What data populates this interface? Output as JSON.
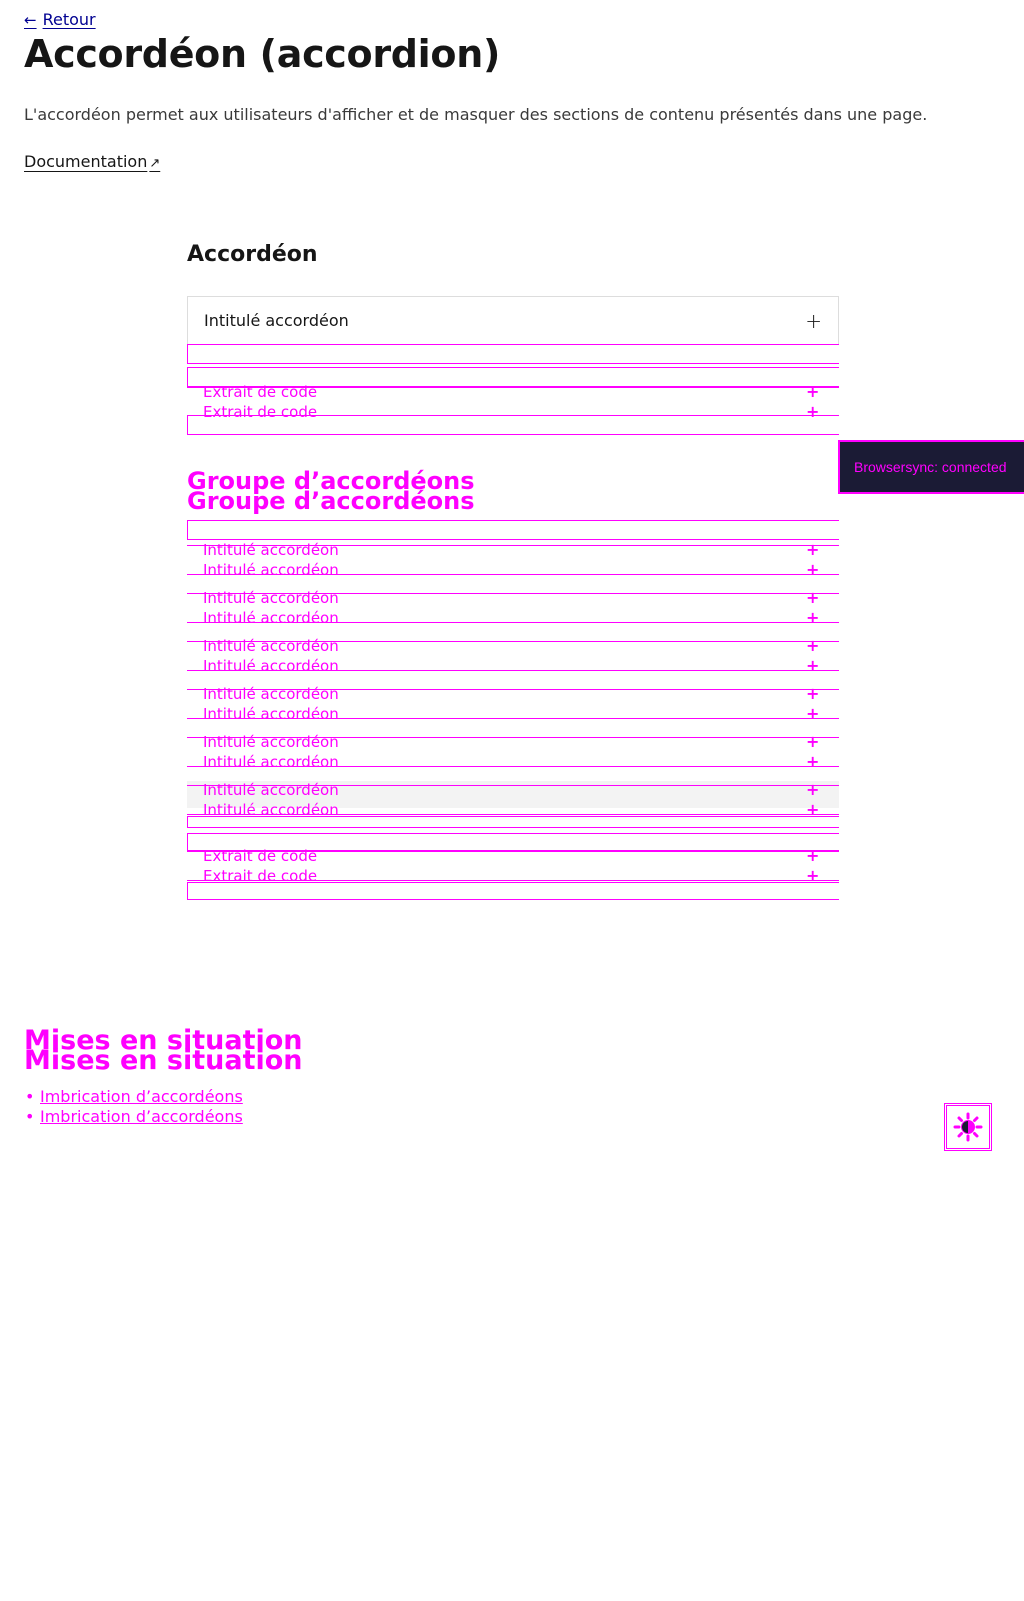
{
  "nav": {
    "back_label": "Retour"
  },
  "header": {
    "title": "Accordéon (accordion)",
    "description": "L'accordéon permet aux utilisateurs d'afficher et de masquer des sections de contenu présentés dans une page.",
    "doc_label": "Documentation"
  },
  "example1": {
    "title": "Accordéon",
    "item_label": "Intitulé accordéon",
    "code_label": "Extrait de code"
  },
  "group": {
    "title": "Groupe d’accordéons",
    "item_label": "Intitulé accordéon",
    "code_label": "Extrait de code"
  },
  "plus_symbol": "+",
  "situations": {
    "title": "Mises en situation",
    "link_label": "Imbrication d’accordéons"
  },
  "browsersync": {
    "message": "Browsersync: connected"
  },
  "colors": {
    "link_blue": "#000091",
    "debug_magenta": "#ff00ff",
    "toast_bg": "#1b1b35"
  }
}
